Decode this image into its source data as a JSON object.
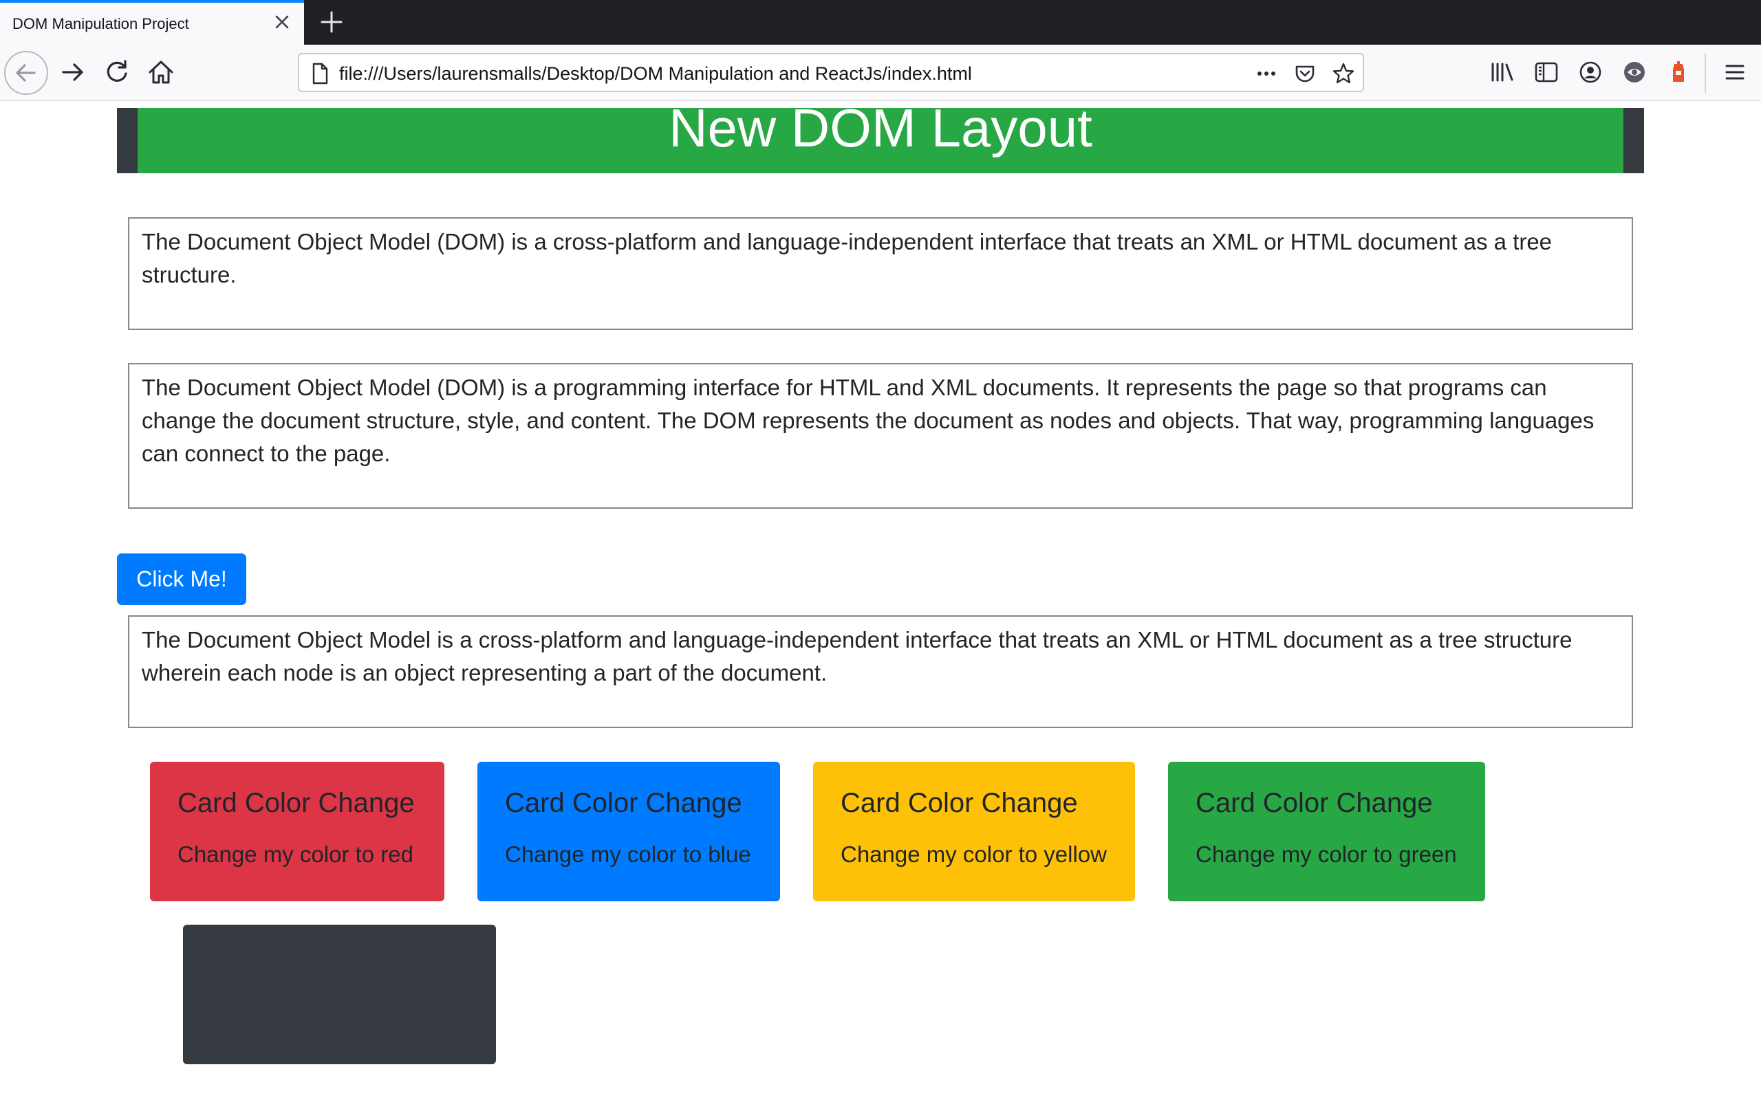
{
  "browser": {
    "tab": {
      "title": "DOM Manipulation Project"
    },
    "address_bar": {
      "url": "file:///Users/laurensmalls/Desktop/DOM Manipulation and ReactJs/index.html"
    }
  },
  "page": {
    "header": {
      "title": "New DOM Layout",
      "bar_color": "#28a745",
      "frame_color": "#343a40"
    },
    "paragraphs": [
      "The Document Object Model (DOM) is a cross-platform and language-independent interface that treats an XML or HTML document as a tree structure.",
      "The Document Object Model (DOM) is a programming interface for HTML and XML documents. It represents the page so that programs can change the document structure, style, and content. The DOM represents the document as nodes and objects. That way, programming languages can connect to the page."
    ],
    "button": {
      "label": "Click Me!",
      "color": "#007bff"
    },
    "result_paragraph": "The Document Object Model is a cross-platform and language-independent interface that treats an XML or HTML document as a tree structure wherein each node is an object representing a part of the document.",
    "cards": [
      {
        "title": "Card Color Change",
        "text": "Change my color to red",
        "color": "#dc3545"
      },
      {
        "title": "Card Color Change",
        "text": "Change my color to blue",
        "color": "#007bff"
      },
      {
        "title": "Card Color Change",
        "text": "Change my color to yellow",
        "color": "#ffc107"
      },
      {
        "title": "Card Color Change",
        "text": "Change my color to green",
        "color": "#28a745"
      }
    ],
    "dark_box": {
      "color": "#343a40"
    }
  }
}
